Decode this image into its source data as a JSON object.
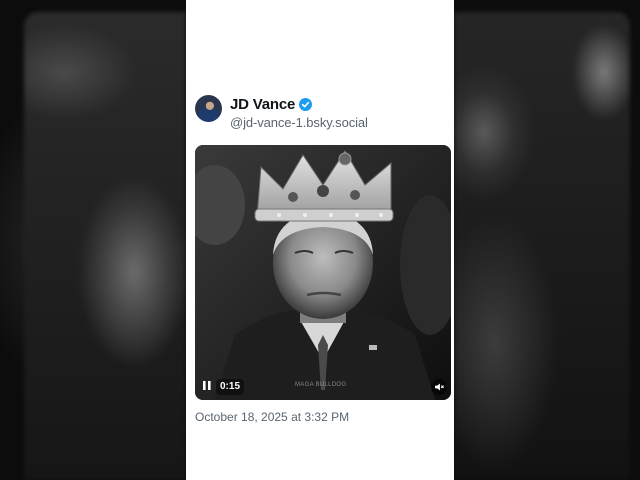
{
  "post": {
    "author": {
      "display_name": "JD Vance",
      "handle": "@jd-vance-1.bsky.social",
      "verified": true
    },
    "media": {
      "type": "video",
      "elapsed": "0:15",
      "watermark": "MAGA BULLDOG",
      "state": "playing",
      "muted": true
    },
    "timestamp": "October 18, 2025 at 3:32 PM"
  },
  "colors": {
    "verified_badge": "#1d9bf0",
    "card_bg": "#ffffff",
    "secondary_text": "#5a6470"
  }
}
